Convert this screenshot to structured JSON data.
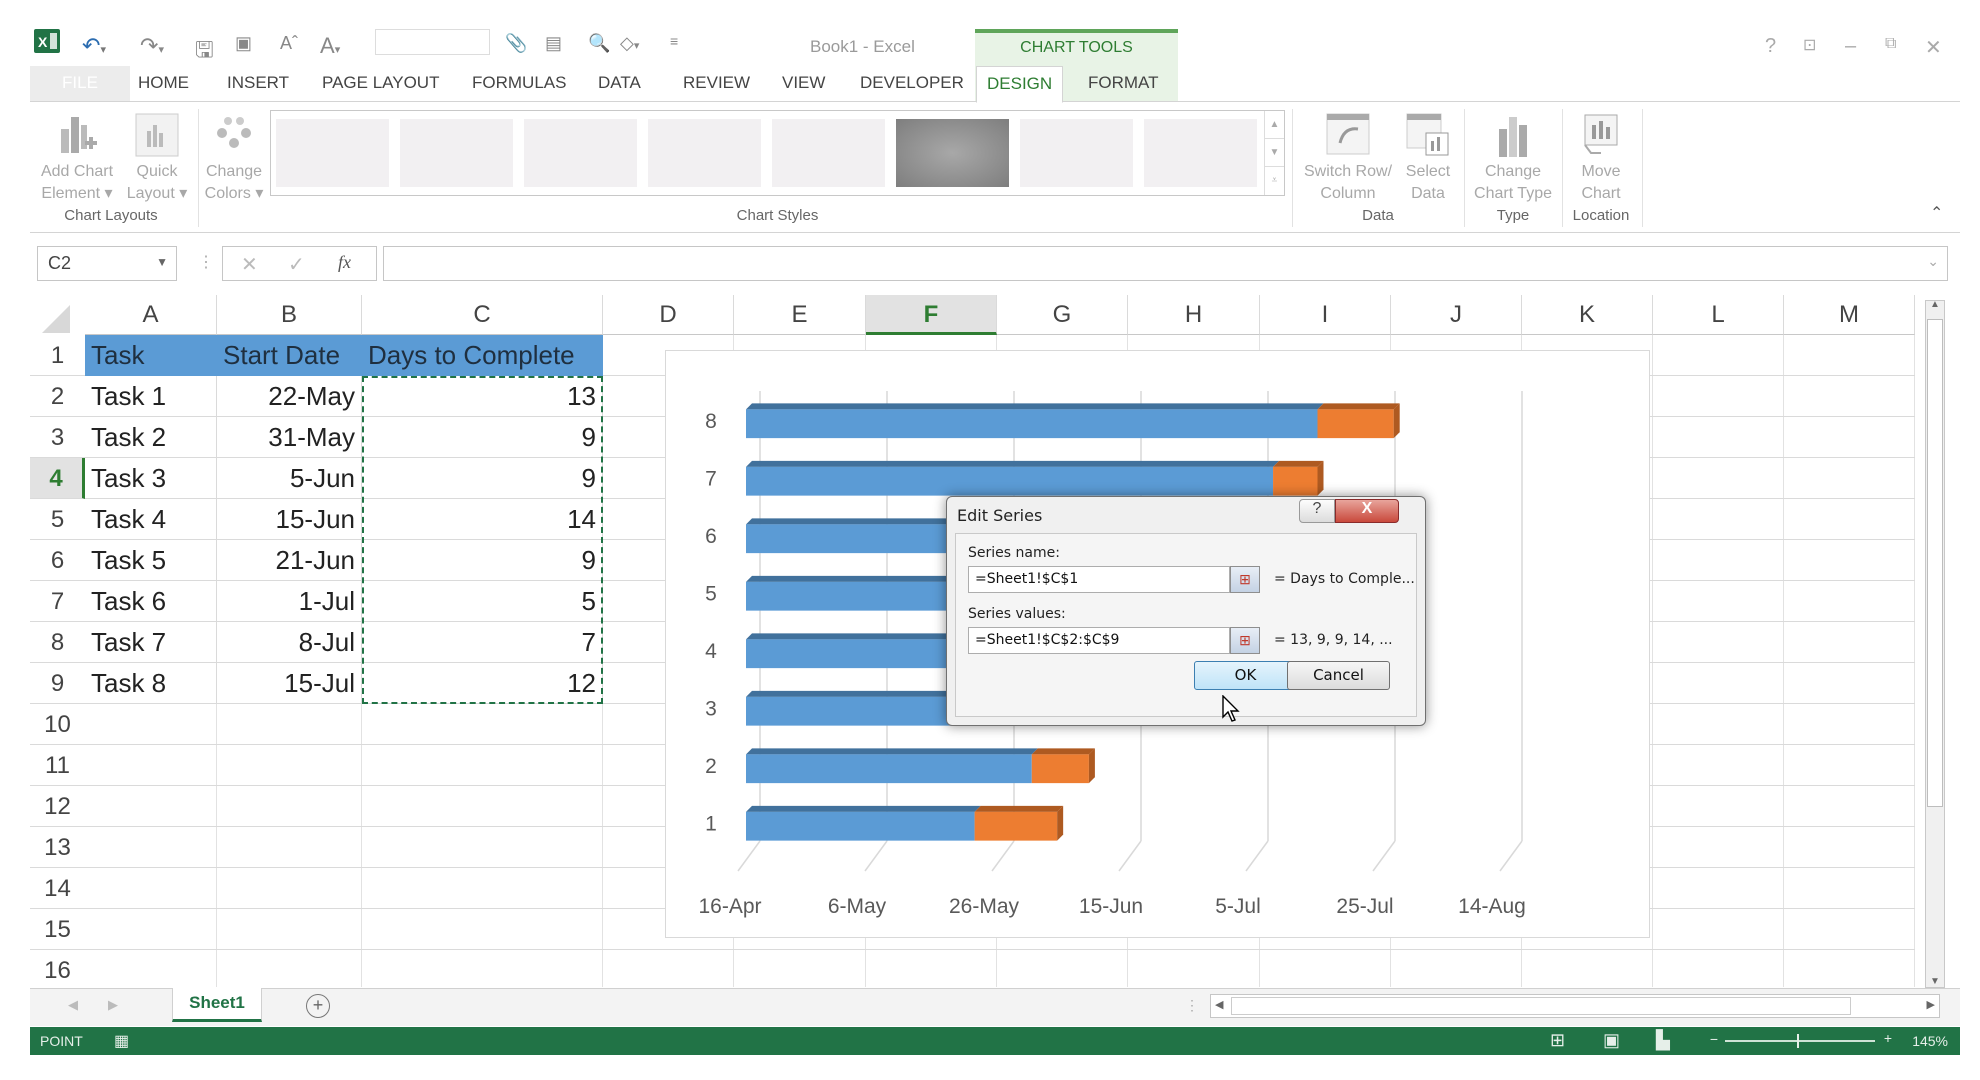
{
  "window": {
    "title": "Book1 - Excel",
    "contextual_tab_group": "CHART TOOLS",
    "controls": [
      "?",
      "ribbon-display",
      "minimize",
      "restore",
      "close"
    ]
  },
  "quick_access": {
    "icons": [
      "excel-logo-icon",
      "undo-icon",
      "redo-icon",
      "save-icon",
      "screenshot-icon",
      "font-grow-icon",
      "font-color-icon",
      "font-dropdown",
      "attach-icon",
      "form-icon",
      "print-preview-icon",
      "shapes-icon",
      "customize-icon"
    ],
    "font_box_value": ""
  },
  "tabs": [
    {
      "label": "FILE",
      "active": false
    },
    {
      "label": "HOME",
      "active": false
    },
    {
      "label": "INSERT",
      "active": false
    },
    {
      "label": "PAGE LAYOUT",
      "active": false
    },
    {
      "label": "FORMULAS",
      "active": false
    },
    {
      "label": "DATA",
      "active": false
    },
    {
      "label": "REVIEW",
      "active": false
    },
    {
      "label": "VIEW",
      "active": false
    },
    {
      "label": "DEVELOPER",
      "active": false
    },
    {
      "label": "DESIGN",
      "active": true
    },
    {
      "label": "FORMAT",
      "active": false
    }
  ],
  "ribbon": {
    "groups": {
      "chart_layouts": "Chart Layouts",
      "chart_styles": "Chart Styles",
      "data": "Data",
      "type": "Type",
      "location": "Location"
    },
    "buttons": {
      "add_chart_element": [
        "Add Chart",
        "Element ▾"
      ],
      "quick_layout": [
        "Quick",
        "Layout ▾"
      ],
      "change_colors": [
        "Change",
        "Colors ▾"
      ],
      "switch_row_column": [
        "Switch Row/",
        "Column"
      ],
      "select_data": [
        "Select",
        "Data"
      ],
      "change_chart_type": [
        "Change",
        "Chart Type"
      ],
      "move_chart": [
        "Move",
        "Chart"
      ]
    },
    "style_gallery_count": 8,
    "style_gallery_selected": 6
  },
  "formula_bar": {
    "name_box": "C2",
    "formula": "",
    "cancel_icon": "✕",
    "enter_icon": "✓",
    "fx_label": "fx"
  },
  "sheet": {
    "columns": [
      "A",
      "B",
      "C",
      "D",
      "E",
      "F",
      "G",
      "H",
      "I",
      "J",
      "K",
      "L",
      "M"
    ],
    "selected_column": "F",
    "rows": [
      1,
      2,
      3,
      4,
      5,
      6,
      7,
      8,
      9,
      10,
      11,
      12,
      13,
      14,
      15,
      16
    ],
    "selected_row": 4,
    "header": [
      "Task",
      "Start Date",
      "Days to Complete"
    ],
    "data": [
      [
        "Task 1",
        "22-May",
        "13"
      ],
      [
        "Task 2",
        "31-May",
        "9"
      ],
      [
        "Task 3",
        "5-Jun",
        "9"
      ],
      [
        "Task 4",
        "15-Jun",
        "14"
      ],
      [
        "Task 5",
        "21-Jun",
        "9"
      ],
      [
        "Task 6",
        "1-Jul",
        "5"
      ],
      [
        "Task 7",
        "8-Jul",
        "7"
      ],
      [
        "Task 8",
        "15-Jul",
        "12"
      ]
    ],
    "copy_marquee_range": "C2:C9",
    "header_fill": "#5b9bd5"
  },
  "chart_data": {
    "type": "bar",
    "orientation": "horizontal",
    "stacked": true,
    "style": "3d",
    "categories": [
      "1",
      "2",
      "3",
      "4",
      "5",
      "6",
      "7",
      "8"
    ],
    "series": [
      {
        "name": "Start Date",
        "color": "#5b9bd5",
        "values_days_from_axis_min": [
          36,
          45,
          50,
          60,
          66,
          76,
          83,
          90
        ],
        "dates": [
          "22-May",
          "31-May",
          "5-Jun",
          "15-Jun",
          "21-Jun",
          "1-Jul",
          "8-Jul",
          "15-Jul"
        ]
      },
      {
        "name": "Days to Complete",
        "color": "#ed7d31",
        "values": [
          13,
          9,
          9,
          14,
          9,
          5,
          7,
          12
        ]
      }
    ],
    "x_tick_labels": [
      "16-Apr",
      "6-May",
      "26-May",
      "15-Jun",
      "5-Jul",
      "25-Jul",
      "14-Aug"
    ],
    "x_range_days": [
      0,
      120
    ],
    "x_tick_interval_days": 20,
    "grid": true,
    "legend": "none",
    "title": ""
  },
  "dialog": {
    "title": "Edit Series",
    "help_label": "?",
    "close_label": "X",
    "series_name_label": "Series name:",
    "series_name_value": "=Sheet1!$C$1",
    "series_name_preview": "= Days to Comple...",
    "series_values_label": "Series values:",
    "series_values_value": "=Sheet1!$C$2:$C$9",
    "series_values_preview": "= 13, 9, 9, 14, ...",
    "ok_label": "OK",
    "cancel_label": "Cancel"
  },
  "sheet_tabs": {
    "tabs": [
      "Sheet1"
    ],
    "active": "Sheet1",
    "add_label": "+"
  },
  "status_bar": {
    "mode": "POINT",
    "zoom": "145%",
    "zoom_fraction": 0.5
  }
}
